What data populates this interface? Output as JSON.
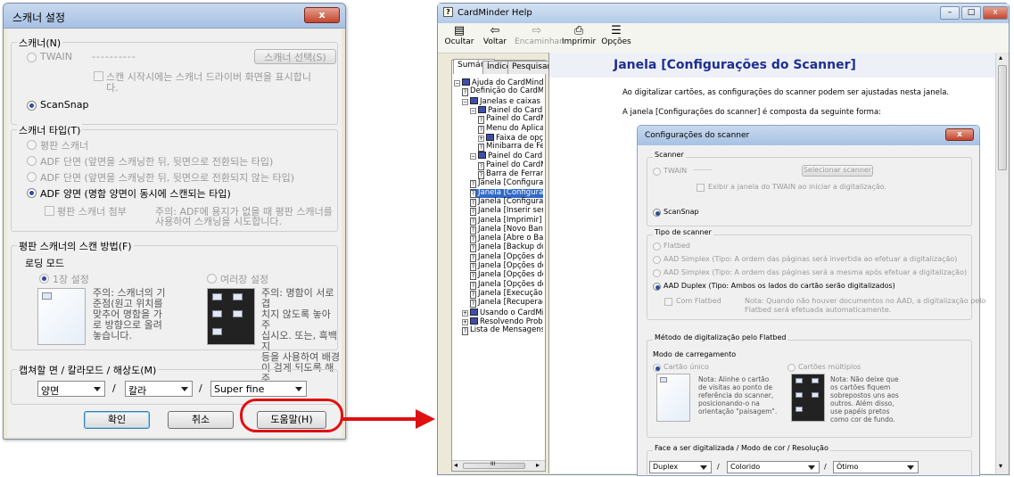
{
  "kr": {
    "title": "스캐너 설정",
    "close": "x",
    "scanner_group": "스캐너(N)",
    "twain_label": "TWAIN",
    "twain_value": "----------",
    "scanner_select": "스캐너 선택(S)",
    "show_driver_line1": "스캔 시작시에는 스캐너 드라이버 화면을 표시합니",
    "show_driver_line2": "다.",
    "scansnap": "ScanSnap",
    "type_group": "스캐너 타입(T)",
    "type_flatbed": "평판 스캐너",
    "type_adf_simplex_rev": "ADF 단면 (앞면을 스캐닝한 뒤, 뒷면으로 전환되는 타입)",
    "type_adf_simplex_norev": "ADF 단면 (앞면을 스캐닝한 뒤, 뒷면으로 전환되지 않는 타입)",
    "type_adf_duplex": "ADF 양면 (명함 양면이 동시에 스캔되는 타입)",
    "flatbed_attach": "평판 스캐너 첨부",
    "attach_note_line1": "주의: ADF에 용지가 없을 때  평판 스캐너를",
    "attach_note_line2": "사용하여 스캐닝을 시도합니다.",
    "method_group": "평판 스캐너의 스캔 방법(F)",
    "loading_mode": "로딩 모드",
    "single": "1장 설정",
    "multiple": "여러장 설정",
    "single_note": [
      "주의: 스캐너의 기",
      "준점(원고 위치를",
      "맞추어 명함을 가",
      "로 방향으로 올려",
      "놓습니다."
    ],
    "multi_note": [
      "주의: 명함이 서로 겹",
      "치지 않도록 놓아 주",
      "십시오. 또는, 흑백지",
      "등을 사용하여 배경",
      "이 검게 되도록 해 주"
    ],
    "capture_group": "캡쳐할 면 / 칼라모드 / 해상도(M)",
    "side_value": "양면",
    "color_value": "칼라",
    "res_value": "Super fine",
    "slash": "/",
    "ok": "확인",
    "cancel": "취소",
    "help": "도움말(H)"
  },
  "help": {
    "title": "CardMinder Help",
    "toolbar": [
      {
        "icon": "▤",
        "label": "Ocultar"
      },
      {
        "icon": "⇦",
        "label": "Voltar"
      },
      {
        "icon": "⇨",
        "label": "Encaminhar"
      },
      {
        "icon": "⎙",
        "label": "Imprimir"
      },
      {
        "icon": "☰",
        "label": "Opções"
      }
    ],
    "tabs": [
      "Sumário",
      "Índice",
      "Pesquisar"
    ],
    "tree": [
      {
        "icon": "book",
        "pm": "−",
        "text": "Ajuda do CardMinder",
        "indent": 0
      },
      {
        "icon": "page",
        "text": "Definição do CardMinder",
        "indent": 1
      },
      {
        "icon": "book",
        "pm": "−",
        "text": "Janelas e caixas de diálogo do Ca",
        "indent": 1
      },
      {
        "icon": "book",
        "pm": "−",
        "text": "Painel do CardMinder",
        "indent": 2
      },
      {
        "icon": "page",
        "text": "Painel do CardMinder",
        "indent": 3
      },
      {
        "icon": "page",
        "text": "Menu do Aplicativo",
        "indent": 3
      },
      {
        "icon": "book",
        "pm": "+",
        "text": "Faixa de opções",
        "indent": 3
      },
      {
        "icon": "page",
        "text": "Minibarra de Ferramentas",
        "indent": 3
      },
      {
        "icon": "book",
        "pm": "−",
        "text": "Painel do CardMinder Viewer",
        "indent": 2
      },
      {
        "icon": "page",
        "text": "Painel do CardMinder Viev",
        "indent": 3
      },
      {
        "icon": "page",
        "text": "Barra de Ferramentas da",
        "indent": 3
      },
      {
        "icon": "page",
        "text": "Janela [Configurações do Car",
        "indent": 2
      },
      {
        "icon": "page",
        "text": "Janela [Configurações do Sca",
        "indent": 2,
        "selected": true
      },
      {
        "icon": "page",
        "text": "Janela [Configurações do Mol",
        "indent": 2
      },
      {
        "icon": "page",
        "text": "Janela [Inserir senha]",
        "indent": 2
      },
      {
        "icon": "page",
        "text": "Janela [Imprimir]",
        "indent": 2
      },
      {
        "icon": "page",
        "text": "Janela [Novo Banco de Dadc",
        "indent": 2
      },
      {
        "icon": "page",
        "text": "Janela [Abre o Banco de Dad",
        "indent": 2
      },
      {
        "icon": "page",
        "text": "Janela [Backup do Banco de",
        "indent": 2
      },
      {
        "icon": "page",
        "text": "Janela [Opções do CardMinde",
        "indent": 2
      },
      {
        "icon": "page",
        "text": "Janela [Opções do CardMinde",
        "indent": 2
      },
      {
        "icon": "page",
        "text": "Janela [Opções do CardMinde",
        "indent": 2
      },
      {
        "icon": "page",
        "text": "Janela [Opções do CardMinde",
        "indent": 2
      },
      {
        "icon": "page",
        "text": "Janela [Execução da Senha]",
        "indent": 2
      },
      {
        "icon": "page",
        "text": "Janela [Recuperação do ban",
        "indent": 2
      },
      {
        "icon": "book",
        "pm": "+",
        "text": "Usando o CardMinder",
        "indent": 1
      },
      {
        "icon": "book",
        "pm": "+",
        "text": "Resolvendo Problemas",
        "indent": 1
      },
      {
        "icon": "page",
        "text": "Lista de Mensagens",
        "indent": 1
      }
    ],
    "heading": "Janela [Configurações do Scanner]",
    "para1": "Ao digitalizar cartões, as configurações do scanner podem ser ajustadas nesta janela.",
    "para2": "A janela [Configurações do scanner] é composta da seguinte forma:",
    "scroll_mark": "III"
  },
  "pt": {
    "title": "Configurações do scanner",
    "close": "x",
    "scanner_group": "Scanner",
    "twain_label": "TWAIN",
    "twain_value": "----------",
    "select_scanner": "Selecionar scanner",
    "show_twain": "Exibir a janela do TWAIN ao iniciar a digitalização.",
    "scansnap": "ScanSnap",
    "type_group": "Tipo de scanner",
    "type_flatbed": "Flatbed",
    "type_simplex_rev": "AAD Simplex (Tipo: A ordem das páginas será invertida ao efetuar a digitalização)",
    "type_simplex_same": "AAD Simplex (Tipo: A ordem das páginas será a mesma após efetuar a digitalização)",
    "type_duplex": "AAD Duplex (Tipo: Ambos os lados do cartão serão digitalizados)",
    "with_flatbed": "Com Flatbed",
    "flatbed_note_line1": "Nota: Quando não houver documentos no AAD, a digitalização pelo",
    "flatbed_note_line2": "Flatbed será efetuada automaticamente.",
    "method_group": "Método de digitalização pelo Flatbed",
    "loading_mode": "Modo de carregamento",
    "single": "Cartão único",
    "multiple": "Cartões múltiplos",
    "single_note": [
      "Nota: Alinhe o cartão",
      "de visitas ao ponto de",
      "referência do scanner,",
      "posicionando-o na",
      "orientação \"paisagem\"."
    ],
    "multi_note": [
      "Nota: Não deixe que",
      "os cartões fiquem",
      "sobrepostos uns aos",
      "outros. Além disso,",
      "use papéis pretos",
      "como cor de fundo."
    ],
    "capture_group": "Face a ser digitalizada / Modo de cor / Resolução",
    "side_value": "Duplex",
    "color_value": "Colorido",
    "res_value": "Ótimo",
    "slash": "/"
  }
}
